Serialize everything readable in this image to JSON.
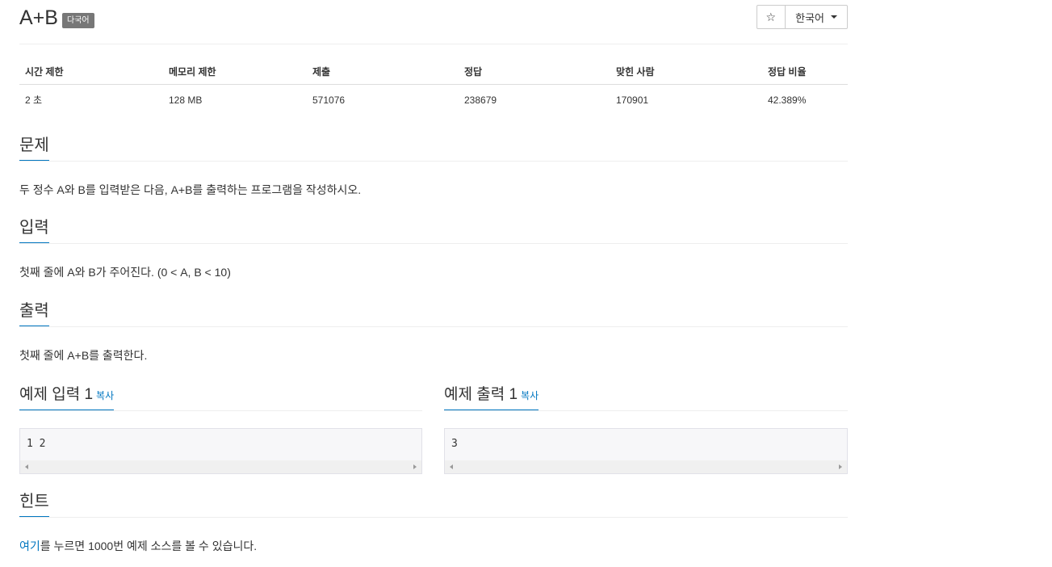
{
  "header": {
    "title": "A+B",
    "badge": "다국어",
    "star_icon": "☆",
    "language_select": "한국어"
  },
  "stats": {
    "columns": [
      "시간 제한",
      "메모리 제한",
      "제출",
      "정답",
      "맞힌 사람",
      "정답 비율"
    ],
    "values": [
      "2 초",
      "128 MB",
      "571076",
      "238679",
      "170901",
      "42.389%"
    ]
  },
  "sections": {
    "problem": {
      "title": "문제",
      "text": "두 정수 A와 B를 입력받은 다음, A+B를 출력하는 프로그램을 작성하시오."
    },
    "input": {
      "title": "입력",
      "text": "첫째 줄에 A와 B가 주어진다. (0 < A, B < 10)"
    },
    "output": {
      "title": "출력",
      "text": "첫째 줄에 A+B를 출력한다."
    },
    "sample_input": {
      "title": "예제 입력 1",
      "copy": "복사",
      "code": "1 2"
    },
    "sample_output": {
      "title": "예제 출력 1",
      "copy": "복사",
      "code": "3"
    },
    "hint": {
      "title": "힌트",
      "link": "여기",
      "text": "를 누르면 1000번 예제 소스를 볼 수 있습니다."
    }
  }
}
